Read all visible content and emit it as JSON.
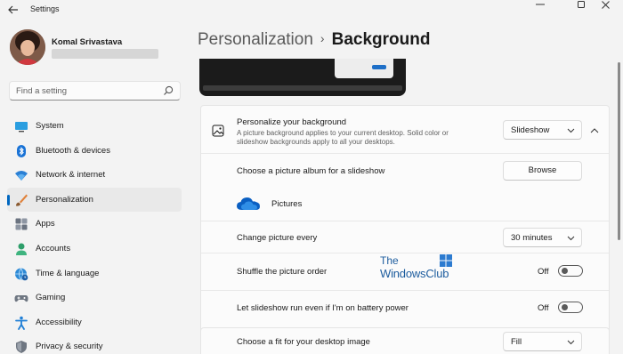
{
  "window": {
    "title": "Settings",
    "back_icon": "←",
    "min_icon": "—",
    "max_icon": "☐",
    "close_icon": "✕"
  },
  "profile": {
    "name": "Komal Srivastava"
  },
  "search": {
    "placeholder": "Find a setting"
  },
  "sidebar": {
    "items": [
      {
        "label": "System",
        "icon": "monitor-icon",
        "selected": false
      },
      {
        "label": "Bluetooth & devices",
        "icon": "bluetooth-icon",
        "selected": false
      },
      {
        "label": "Network & internet",
        "icon": "wifi-icon",
        "selected": false
      },
      {
        "label": "Personalization",
        "icon": "brush-icon",
        "selected": true
      },
      {
        "label": "Apps",
        "icon": "apps-icon",
        "selected": false
      },
      {
        "label": "Accounts",
        "icon": "person-icon",
        "selected": false
      },
      {
        "label": "Time & language",
        "icon": "globe-clock-icon",
        "selected": false
      },
      {
        "label": "Gaming",
        "icon": "gamepad-icon",
        "selected": false
      },
      {
        "label": "Accessibility",
        "icon": "accessibility-icon",
        "selected": false
      },
      {
        "label": "Privacy & security",
        "icon": "shield-icon",
        "selected": false
      }
    ]
  },
  "breadcrumb": {
    "parent": "Personalization",
    "separator": "›",
    "current": "Background"
  },
  "background_card": {
    "title": "Personalize your background",
    "description": "A picture background applies to your current desktop. Solid color or slideshow backgrounds apply to all your desktops.",
    "type_value": "Slideshow",
    "album_label": "Choose a picture album for a slideshow",
    "browse_label": "Browse",
    "album_name": "Pictures",
    "change_label": "Change picture every",
    "change_value": "30 minutes",
    "shuffle_label": "Shuffle the picture order",
    "shuffle_state": "Off",
    "battery_label": "Let slideshow run even if I'm on battery power",
    "battery_state": "Off"
  },
  "fit_card": {
    "label": "Choose a fit for your desktop image",
    "value": "Fill"
  },
  "watermark": {
    "line1": "The",
    "line2": "WindowsClub"
  },
  "colors": {
    "accent": "#0067c0",
    "window_bg": "#f3f3f3",
    "card_bg": "#fbfbfb"
  }
}
